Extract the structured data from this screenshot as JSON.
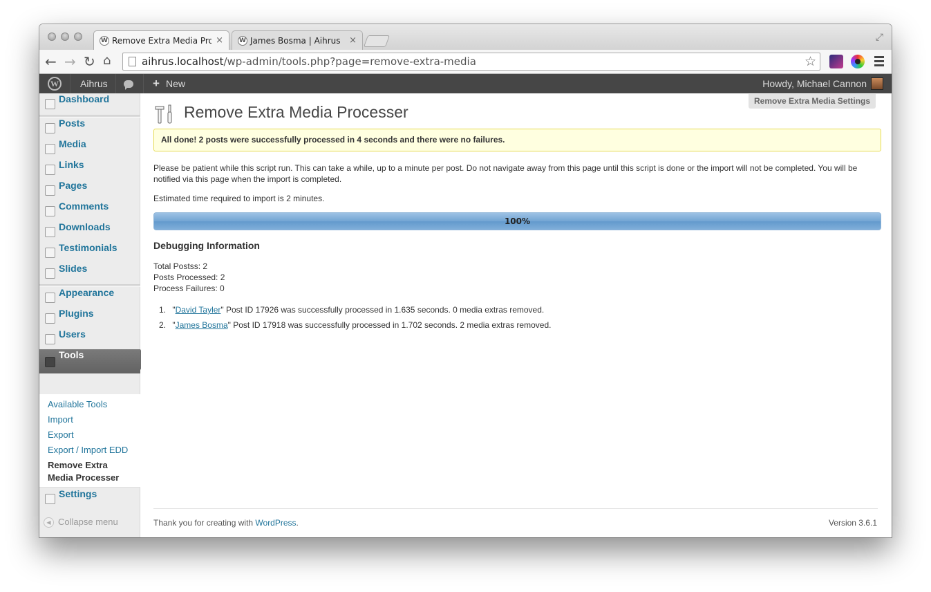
{
  "browser": {
    "tabs": [
      {
        "title": "Remove Extra Media Processer",
        "active": true
      },
      {
        "title": "James Bosma | Aihrus",
        "active": false
      }
    ],
    "url": {
      "host": "aihrus.localhost",
      "path": "/wp-admin/tools.php?page=remove-extra-media"
    }
  },
  "adminbar": {
    "site_name": "Aihrus",
    "new_label": "New",
    "greeting": "Howdy, Michael Cannon"
  },
  "sidebar": {
    "items": [
      {
        "label": "Dashboard",
        "icon": "house-icon"
      },
      {
        "label": "Posts",
        "icon": "pin-icon"
      },
      {
        "label": "Media",
        "icon": "media-icon"
      },
      {
        "label": "Links",
        "icon": "link-icon"
      },
      {
        "label": "Pages",
        "icon": "page-icon"
      },
      {
        "label": "Comments",
        "icon": "comment-icon"
      },
      {
        "label": "Downloads",
        "icon": "download-icon"
      },
      {
        "label": "Testimonials",
        "icon": "pin-icon"
      },
      {
        "label": "Slides",
        "icon": "slides-icon"
      },
      {
        "label": "Appearance",
        "icon": "appearance-icon"
      },
      {
        "label": "Plugins",
        "icon": "plug-icon"
      },
      {
        "label": "Users",
        "icon": "users-icon"
      },
      {
        "label": "Tools",
        "icon": "tools-icon"
      },
      {
        "label": "Settings",
        "icon": "settings-icon"
      }
    ],
    "submenu": [
      "Available Tools",
      "Import",
      "Export",
      "Export / Import EDD",
      "Remove Extra Media Processer"
    ],
    "collapse_label": "Collapse menu"
  },
  "main": {
    "title": "Remove Extra Media Processer",
    "settings_button": "Remove Extra Media Settings",
    "notice": "All done! 2 posts were successfully processed in 4 seconds and there were no failures.",
    "intro": "Please be patient while this script run. This can take a while, up to a minute per post. Do not navigate away from this page until this script is done or the import will not be completed. You will be notified via this page when the import is completed.",
    "estimate": "Estimated time required to import is 2 minutes.",
    "progress": {
      "value": 100,
      "label": "100%"
    },
    "debug_heading": "Debugging Information",
    "stats": [
      "Total Postss: 2",
      "Posts Processed: 2",
      "Process Failures: 0"
    ],
    "results": [
      {
        "num": "1.",
        "name": "David Tayler",
        "text": "\" Post ID 17926 was successfully processed in 1.635 seconds. 0 media extras removed."
      },
      {
        "num": "2.",
        "name": "James Bosma",
        "text": "\" Post ID 17918 was successfully processed in 1.702 seconds. 2 media extras removed."
      }
    ]
  },
  "footer": {
    "thanks_prefix": "Thank you for creating with ",
    "thanks_link": "WordPress",
    "thanks_suffix": ".",
    "version": "Version 3.6.1"
  },
  "colors": {
    "link": "#21759b",
    "adminbar": "#464646",
    "notice_bg": "#ffffe0",
    "progress": "#7aaad6"
  }
}
